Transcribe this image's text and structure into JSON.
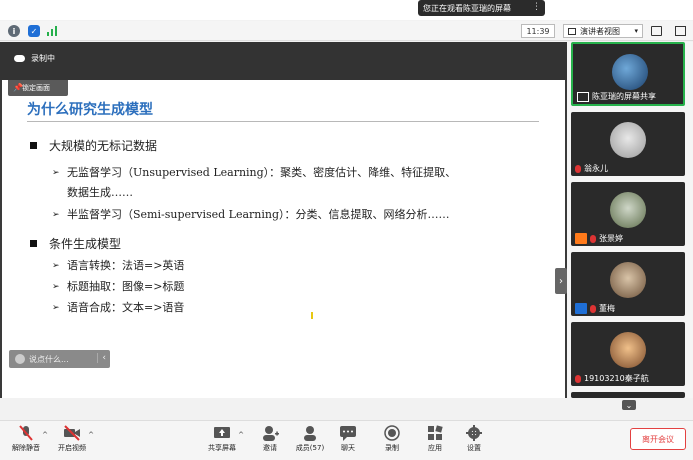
{
  "notification": {
    "text": "您正在观看陈亚瑞的屏幕",
    "more": "⋮"
  },
  "statusbar": {
    "time": "11:39",
    "view_label": "演讲者视图"
  },
  "recording": {
    "label": "录制中"
  },
  "pinned_tab": {
    "label": "锁定画面"
  },
  "slide": {
    "title": "为什么研究生成模型",
    "bullets": [
      {
        "text": "大规模的无标记数据",
        "sub": [
          {
            "line1": "无监督学习（Unsupervised Learning）：聚类、密度估计、降维、特征提取、",
            "line2": "数据生成……"
          },
          {
            "line1": "半监督学习（Semi-supervised Learning）：分类、信息提取、网络分析……"
          }
        ]
      },
      {
        "text": "条件生成模型",
        "sub": [
          {
            "line1": "语言转换：法语=>英语"
          },
          {
            "line1": "标题抽取：图像=>标题"
          },
          {
            "line1": "语音合成：文本=>语音"
          }
        ]
      }
    ]
  },
  "chat_input": {
    "placeholder": "说点什么..."
  },
  "participants": [
    {
      "name": "陈亚瑞的屏幕共享",
      "active": true
    },
    {
      "name": "翁永儿"
    },
    {
      "name": "张景婷"
    },
    {
      "name": "董梅"
    },
    {
      "name": "19103210秦子航"
    }
  ],
  "toolbar": {
    "unmute": "解除静音",
    "start_video": "开启视频",
    "share_screen": "共享屏幕",
    "invite": "邀请",
    "members": "成员(57)",
    "chat": "聊天",
    "record": "录制",
    "apps": "应用",
    "settings": "设置",
    "leave": "离开会议"
  },
  "colors": {
    "accent_green": "#27b24c",
    "leave_red": "#e34141",
    "title_blue": "#2c6fbd"
  }
}
